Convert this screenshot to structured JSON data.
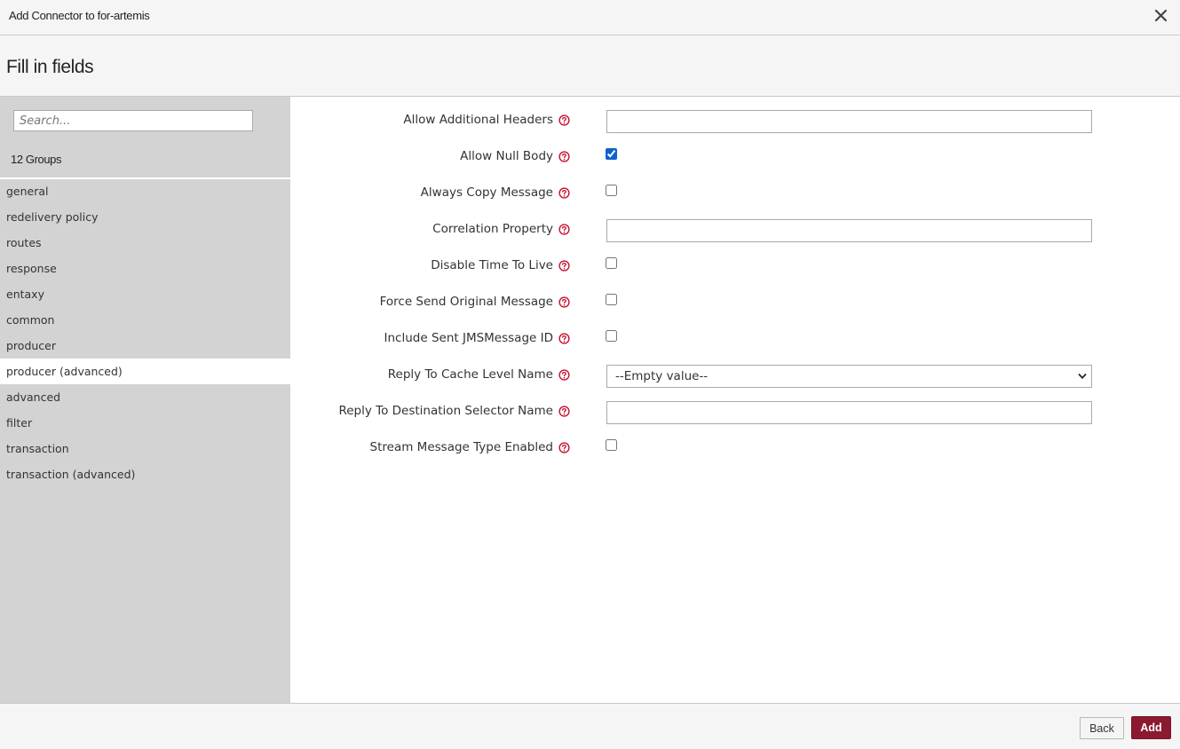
{
  "dialog": {
    "title": "Add Connector to for-artemis",
    "heading": "Fill in fields"
  },
  "sidebar": {
    "search_placeholder": "Search...",
    "groups_count": "12 Groups",
    "groups": [
      {
        "label": "general",
        "active": false
      },
      {
        "label": "redelivery policy",
        "active": false
      },
      {
        "label": "routes",
        "active": false
      },
      {
        "label": "response",
        "active": false
      },
      {
        "label": "entaxy",
        "active": false
      },
      {
        "label": "common",
        "active": false
      },
      {
        "label": "producer",
        "active": false
      },
      {
        "label": "producer (advanced)",
        "active": true
      },
      {
        "label": "advanced",
        "active": false
      },
      {
        "label": "filter",
        "active": false
      },
      {
        "label": "transaction",
        "active": false
      },
      {
        "label": "transaction (advanced)",
        "active": false
      }
    ]
  },
  "fields": [
    {
      "label": "Allow Additional Headers",
      "type": "text",
      "value": ""
    },
    {
      "label": "Allow Null Body",
      "type": "checkbox",
      "checked": true
    },
    {
      "label": "Always Copy Message",
      "type": "checkbox",
      "checked": false
    },
    {
      "label": "Correlation Property",
      "type": "text",
      "value": ""
    },
    {
      "label": "Disable Time To Live",
      "type": "checkbox",
      "checked": false
    },
    {
      "label": "Force Send Original Message",
      "type": "checkbox",
      "checked": false
    },
    {
      "label": "Include Sent JMSMessage ID",
      "type": "checkbox",
      "checked": false
    },
    {
      "label": "Reply To Cache Level Name",
      "type": "select",
      "value": "--Empty value--"
    },
    {
      "label": "Reply To Destination Selector Name",
      "type": "text",
      "value": ""
    },
    {
      "label": "Stream Message Type Enabled",
      "type": "checkbox",
      "checked": false
    }
  ],
  "footer": {
    "back_label": "Back",
    "add_label": "Add"
  },
  "colors": {
    "accent": "#8b1a30",
    "help_icon": "#c8102e",
    "checkbox_checked": "#0b63ce",
    "sidebar_bg": "#d3d3d3",
    "header_bg": "#f5f5f5"
  },
  "icons": {
    "close": "close-icon",
    "help": "help-circle-icon",
    "select_chevron": "chevron-down-icon"
  }
}
